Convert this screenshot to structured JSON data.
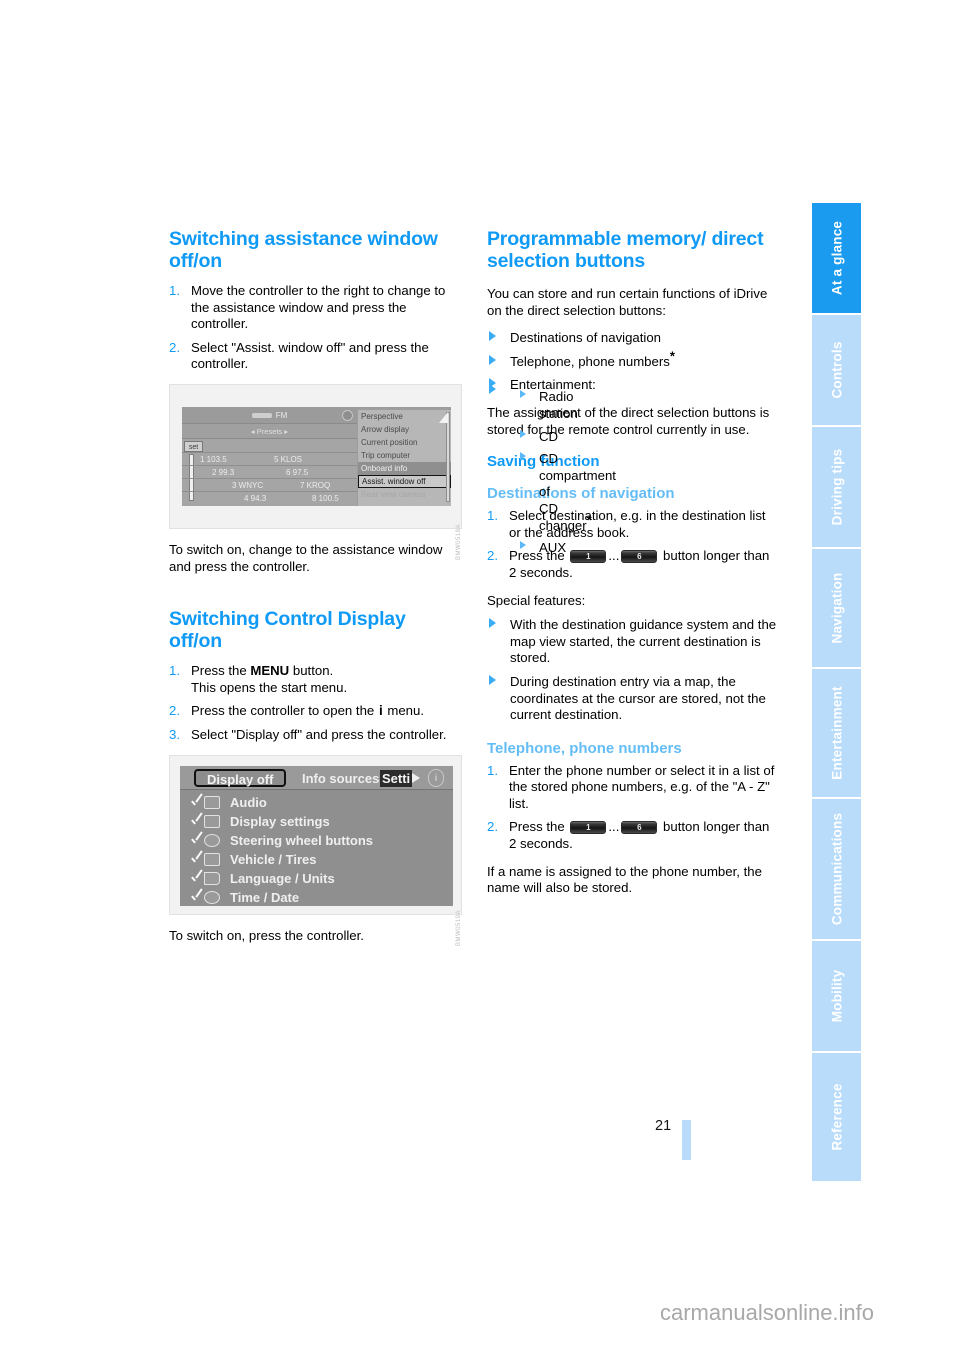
{
  "document": {
    "page_number": "21",
    "watermark": "carmanualsonline.info"
  },
  "side_tabs": [
    {
      "label": "At a glance",
      "active": true
    },
    {
      "label": "Controls",
      "active": false
    },
    {
      "label": "Driving tips",
      "active": false
    },
    {
      "label": "Navigation",
      "active": false
    },
    {
      "label": "Entertainment",
      "active": false
    },
    {
      "label": "Communications",
      "active": false
    },
    {
      "label": "Mobility",
      "active": false
    },
    {
      "label": "Reference",
      "active": false
    }
  ],
  "left_column": {
    "section1": {
      "heading": "Switching assistance window off/on",
      "steps": [
        {
          "num": "1.",
          "text": "Move the controller to the right to change to the assistance window and press the controller."
        },
        {
          "num": "2.",
          "text": "Select \"Assist. window off\" and press the controller."
        }
      ],
      "figure": {
        "band_label": "FM",
        "presets_label": "Presets",
        "set_label": "set",
        "presets": [
          "1 103.5",
          "5 KLOS",
          "2 99.3",
          "6 97.5",
          "3 WNYC",
          "7 KROQ",
          "4 94.3",
          "8 100.5"
        ],
        "menu_items": [
          "Perspective",
          "Arrow display",
          "Current position",
          "Trip computer",
          "Onboard info",
          "Assist. window off",
          "Rear view  camera"
        ],
        "highlighted_item": "Onboard info",
        "selected_item": "Assist. window off",
        "caption": "BMW0518A"
      },
      "after_text": "To switch on, change to the assistance window and press the controller."
    },
    "section2": {
      "heading": "Switching Control Display off/on",
      "steps": [
        {
          "num": "1.",
          "text_a": "Press the ",
          "bold": "MENU",
          "text_b": " button.",
          "text_c": "This opens the start menu."
        },
        {
          "num": "2.",
          "text_a": "Press the controller to open the ",
          "glyph": "i",
          "text_b": " menu."
        },
        {
          "num": "3.",
          "text": "Select \"Display off\" and press the controller."
        }
      ],
      "figure": {
        "tabs": [
          "Display off",
          "Info sources",
          "Setti"
        ],
        "selected_tab": "Display off",
        "rows": [
          "Audio",
          "Display settings",
          "Steering wheel buttons",
          "Vehicle / Tires",
          "Language / Units",
          "Time / Date"
        ],
        "caption": "BMW0519A"
      },
      "after_text": "To switch on, press the controller."
    }
  },
  "right_column": {
    "heading": "Programmable memory/ direct selection buttons",
    "intro": "You can store and run certain functions of iDrive on the direct selection buttons:",
    "bullets": [
      {
        "text": "Destinations of navigation",
        "star": false
      },
      {
        "text": "Telephone, phone numbers",
        "star": true
      },
      {
        "text": "Entertainment:",
        "star": false,
        "children": [
          {
            "text": "Radio station",
            "star": false
          },
          {
            "text": "CD",
            "star": false
          },
          {
            "text": "CD compartment of CD changer",
            "star": true
          },
          {
            "text": "AUX",
            "star": false
          }
        ]
      }
    ],
    "assignment_note": "The assignment of the direct selection buttons is stored for the remote control currently in use.",
    "saving_function": {
      "heading": "Saving function",
      "destinations": {
        "heading": "Destinations of navigation",
        "steps": [
          {
            "num": "1.",
            "text": "Select destination, e.g. in the destination list or the address book."
          },
          {
            "num": "2.",
            "text_a": "Press the ",
            "btn1": "1",
            "ellipsis": "...",
            "btn2": "6",
            "text_b": " button longer than 2 seconds."
          }
        ],
        "special_label": "Special features:",
        "special": [
          "With the destination guidance system and the map view started, the current destination is stored.",
          "During destination entry via a map, the coordinates at the cursor are stored, not the current destination."
        ]
      },
      "telephone": {
        "heading": "Telephone, phone numbers",
        "steps": [
          {
            "num": "1.",
            "text": "Enter the phone number or select it in a list of the stored phone numbers, e.g. of the \"A - Z\" list."
          },
          {
            "num": "2.",
            "text_a": "Press the ",
            "btn1": "1",
            "ellipsis": "...",
            "btn2": "6",
            "text_b": " button longer than 2 seconds."
          }
        ],
        "note": "If a name is assigned to the phone number, the name will also be stored."
      }
    }
  },
  "colors": {
    "accent_blue": "#0f9af5",
    "light_blue": "#64bdf7",
    "tab_inactive": "#b9dcfb",
    "tab_active": "#1a9bf0"
  }
}
